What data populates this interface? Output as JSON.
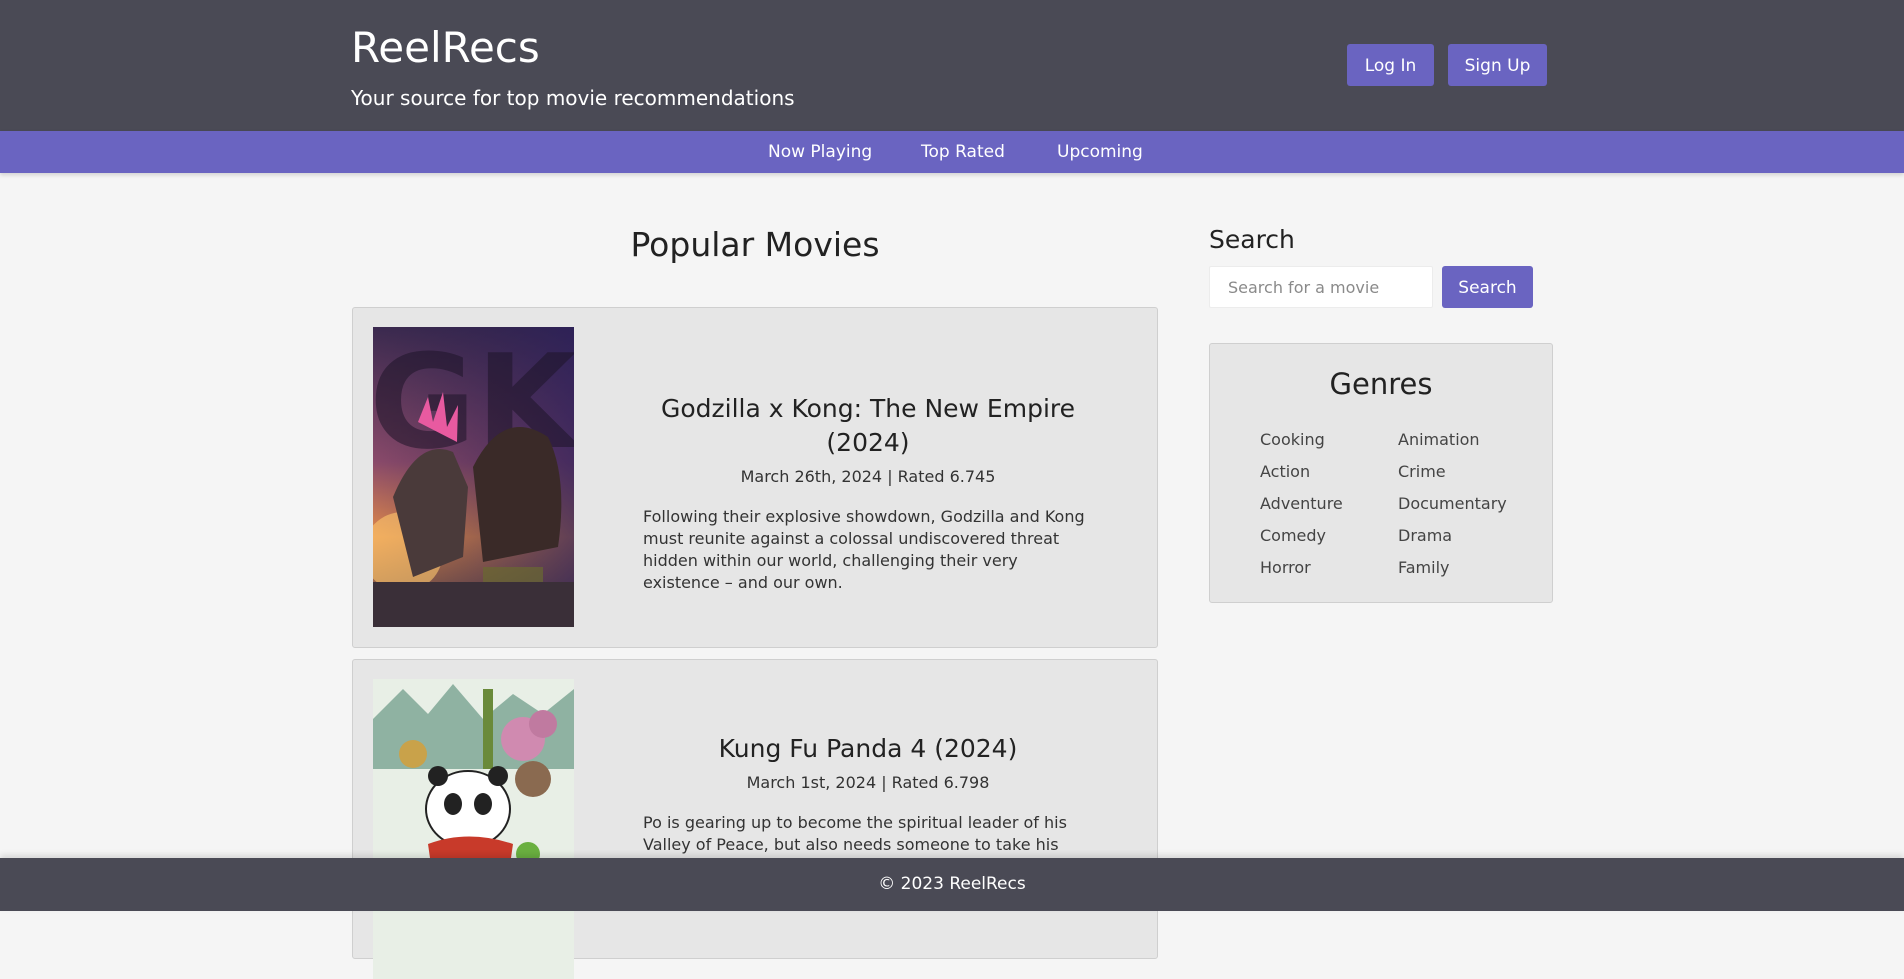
{
  "header": {
    "brand": "ReelRecs",
    "tagline": "Your source for top movie recommendations",
    "login_label": "Log In",
    "signup_label": "Sign Up"
  },
  "nav": {
    "items": [
      "Now Playing",
      "Top Rated",
      "Upcoming"
    ]
  },
  "main": {
    "title": "Popular Movies",
    "movies": [
      {
        "title": "Godzilla x Kong: The New Empire (2024)",
        "meta": "March 26th, 2024 | Rated 6.745",
        "description": "Following their explosive showdown, Godzilla and Kong must reunite against a colossal undiscovered threat hidden within our world, challenging their very existence – and our own.",
        "poster_text": "GK"
      },
      {
        "title": "Kung Fu Panda 4 (2024)",
        "meta": "March 1st, 2024 | Rated 6.798",
        "description": "Po is gearing up to become the spiritual leader of his Valley of Peace, but also needs someone to take his place as"
      }
    ]
  },
  "sidebar": {
    "search_heading": "Search",
    "search_placeholder": "Search for a movie",
    "search_button": "Search",
    "genres_title": "Genres",
    "genres_left": [
      "Cooking",
      "Action",
      "Adventure",
      "Comedy",
      "Horror"
    ],
    "genres_right": [
      "Animation",
      "Crime",
      "Documentary",
      "Drama",
      "Family"
    ]
  },
  "footer": {
    "text": "© 2023 ReelRecs"
  },
  "colors": {
    "header_bg": "#4a4a55",
    "accent": "#6a64c1",
    "page_bg": "#f5f5f5",
    "card_bg": "#e6e6e6"
  }
}
